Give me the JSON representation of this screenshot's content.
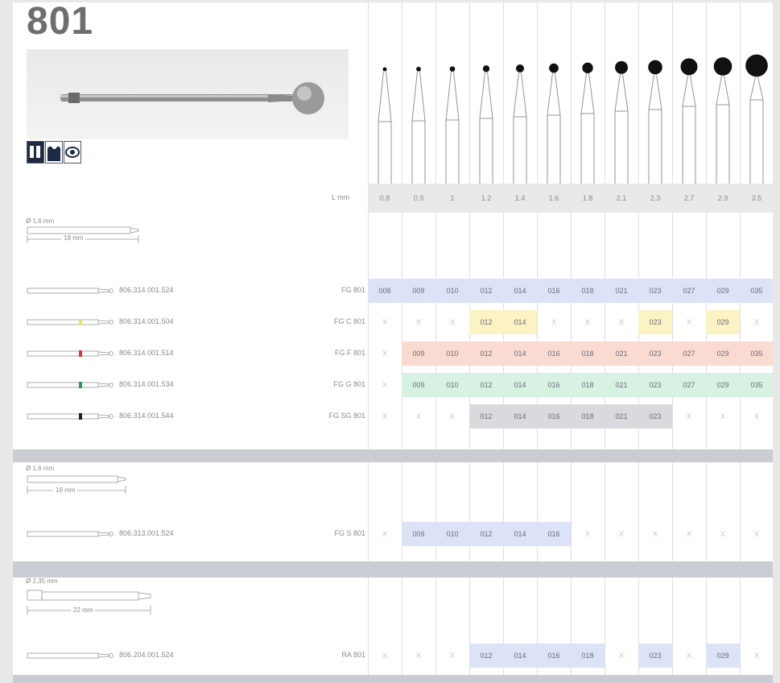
{
  "title": "801",
  "length_label": "L mm",
  "column_sizes": [
    "0.8",
    "0.9",
    "1",
    "1.2",
    "1.4",
    "1.6",
    "1.8",
    "2.1",
    "2.3",
    "2.7",
    "2.9",
    "3.5"
  ],
  "column_headers": [
    "008",
    "009",
    "010",
    "012",
    "014",
    "016",
    "018",
    "021",
    "023",
    "027",
    "029",
    "035"
  ],
  "shanks": [
    {
      "diameter": "Ø 1,6 mm",
      "length": "19 mm"
    },
    {
      "diameter": "Ø 1,6 mm",
      "length": "16 mm"
    },
    {
      "diameter": "Ø 2,35 mm",
      "length": "22 mm"
    }
  ],
  "rows": [
    {
      "article": "806.314.001.524",
      "code": "FG 801",
      "color_band": "",
      "cells": [
        "008",
        "009",
        "010",
        "012",
        "014",
        "016",
        "018",
        "021",
        "023",
        "027",
        "029",
        "035"
      ],
      "highlight": "#dce3f6"
    },
    {
      "article": "806.314.001.504",
      "code": "FG C 801",
      "color_band": "#e9e36a",
      "cells": [
        "X",
        "X",
        "X",
        "012",
        "014",
        "X",
        "X",
        "X",
        "023",
        "X",
        "029",
        "X"
      ],
      "highlight": "#fbf3c3"
    },
    {
      "article": "806.314.001.514",
      "code": "FG F 801",
      "color_band": "#d43a3a",
      "cells": [
        "X",
        "009",
        "010",
        "012",
        "014",
        "016",
        "018",
        "021",
        "023",
        "027",
        "029",
        "035"
      ],
      "highlight": "#f9dbd2"
    },
    {
      "article": "806.314.001.534",
      "code": "FG G 801",
      "color_band": "#2a9a5a",
      "cells": [
        "X",
        "009",
        "010",
        "012",
        "014",
        "016",
        "018",
        "021",
        "023",
        "027",
        "029",
        "035"
      ],
      "highlight": "#d7f1e3"
    },
    {
      "article": "806.314.001.544",
      "code": "FG SG 801",
      "color_band": "#222222",
      "cells": [
        "X",
        "X",
        "X",
        "012",
        "014",
        "016",
        "018",
        "021",
        "023",
        "X",
        "X",
        "X"
      ],
      "highlight": "#d9dadd"
    },
    {
      "article": "806.313.001.524",
      "code": "FG S 801",
      "color_band": "",
      "cells": [
        "X",
        "009",
        "010",
        "012",
        "014",
        "016",
        "X",
        "X",
        "X",
        "X",
        "X",
        "X"
      ],
      "highlight": "#dce3f6"
    },
    {
      "article": "806.204.001.524",
      "code": "RA 801",
      "color_band": "",
      "cells": [
        "X",
        "X",
        "X",
        "012",
        "014",
        "016",
        "018",
        "X",
        "023",
        "X",
        "029",
        "X"
      ],
      "highlight": "#dce3f6"
    }
  ],
  "icons": [
    "crown-prep-icon",
    "cavity-prep-icon",
    "eye-icon"
  ],
  "colors": {
    "header_bg": "#e9e9e9",
    "separator": "#c9ccd2",
    "page_bg": "#e8e8e8"
  }
}
